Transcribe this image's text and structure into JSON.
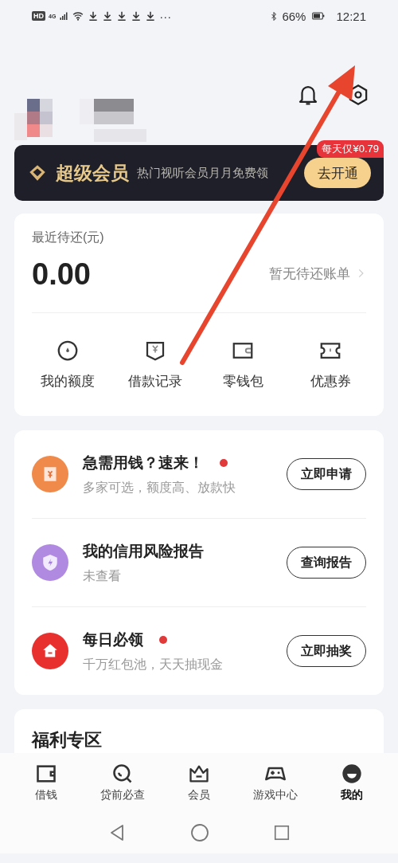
{
  "status_bar": {
    "badges": [
      "HD",
      "4G"
    ],
    "more": "···",
    "battery": "66%",
    "time": "12:21"
  },
  "profile": {
    "blurred": true
  },
  "vip_banner": {
    "title": "超级会员",
    "subtitle": "热门视听会员月月免费领",
    "button": "去开通",
    "price_tag": "每天仅¥0.79"
  },
  "repay_card": {
    "label": "最近待还(元)",
    "amount": "0.00",
    "link": "暂无待还账单",
    "shortcuts": [
      {
        "label": "我的额度"
      },
      {
        "label": "借款记录"
      },
      {
        "label": "零钱包"
      },
      {
        "label": "优惠券"
      }
    ]
  },
  "services": [
    {
      "title": "急需用钱？速来！",
      "subtitle": "多家可选，额度高、放款快",
      "button": "立即申请",
      "new_dot": true,
      "color": "#f08a4b"
    },
    {
      "title": "我的信用风险报告",
      "subtitle": "未查看",
      "button": "查询报告",
      "new_dot": false,
      "color": "#b08ae0"
    },
    {
      "title": "每日必领",
      "subtitle": "千万红包池，天天抽现金",
      "button": "立即抽奖",
      "new_dot": true,
      "color": "#e8302e"
    }
  ],
  "welfare": {
    "title": "福利专区"
  },
  "tabs": [
    {
      "label": "借钱",
      "selected": false
    },
    {
      "label": "贷前必查",
      "selected": false
    },
    {
      "label": "会员",
      "selected": false
    },
    {
      "label": "游戏中心",
      "selected": false
    },
    {
      "label": "我的",
      "selected": true
    }
  ]
}
